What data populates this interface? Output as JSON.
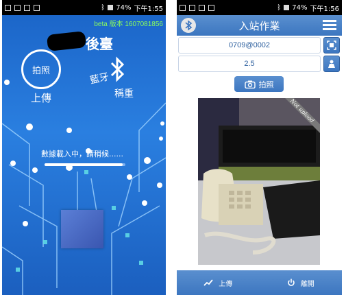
{
  "left": {
    "status": {
      "battery": "74%",
      "time": "下午1:55"
    },
    "beta_label": "beta 版本 1607081856",
    "title_suffix": "後臺",
    "photo_button": "拍照",
    "upload_label": "上傳",
    "bluetooth_label": "藍牙",
    "weigh_label": "稱重",
    "loading_text": "數據載入中，請稍候......",
    "loading_progress": 0.97
  },
  "right": {
    "status": {
      "battery": "74%",
      "time": "下午1:56"
    },
    "header_title": "入站作業",
    "code_field": "0709@0002",
    "weight_field": "2.5",
    "photo_button": "拍照",
    "photo_badge": "Not upload",
    "footer": {
      "upload": "上傳",
      "leave": "離開"
    }
  },
  "colors": {
    "accent": "#3c76c0",
    "beta_green": "#8dff5a",
    "field_text": "#2c5f9e"
  },
  "icons": [
    "bluetooth-icon",
    "menu-icon",
    "scan-icon",
    "scale-icon",
    "camera-icon",
    "trend-icon",
    "power-icon"
  ]
}
